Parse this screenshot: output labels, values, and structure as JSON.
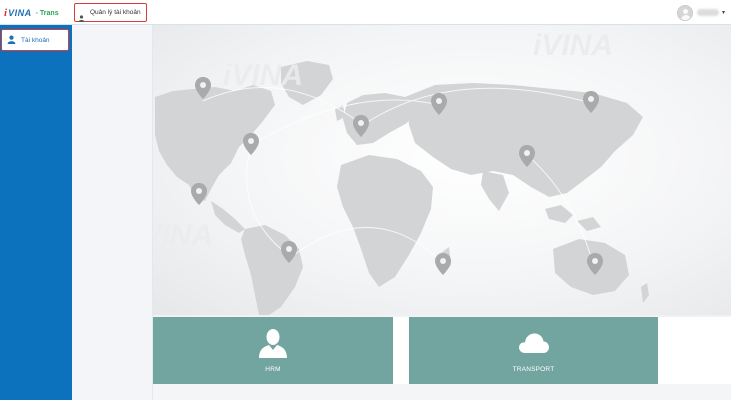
{
  "brand": {
    "logo_i": "i",
    "logo_vina": "VINA",
    "separator": "-",
    "product": "Trans"
  },
  "top_menu": {
    "label": "Quản lý tài khoản",
    "icon": "user-icon"
  },
  "user_menu": {
    "icon": "avatar",
    "caret": "▾"
  },
  "sidebar": {
    "items": [
      {
        "label": "Tài khoản",
        "icon": "user-icon"
      }
    ]
  },
  "tiles": [
    {
      "label": "HRM",
      "icon": "person-icon"
    },
    {
      "label": "TRANSPORT",
      "icon": "cloud-icon"
    }
  ],
  "colors": {
    "sidebar": "#0d72be",
    "tile": "#72a4a0",
    "highlight_border": "#d93b3b",
    "map_land": "#d3d4d6",
    "map_pin": "#a9aaac"
  }
}
